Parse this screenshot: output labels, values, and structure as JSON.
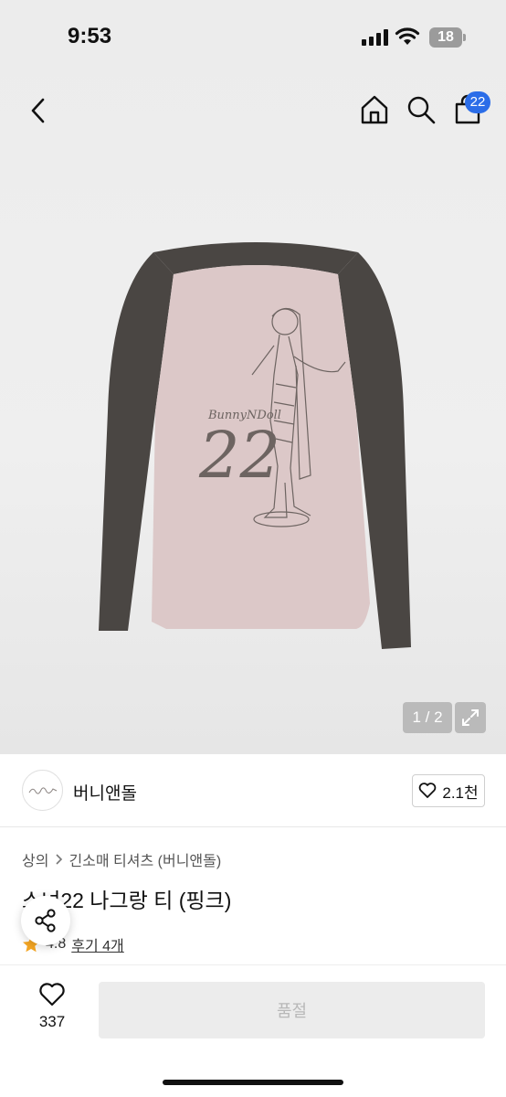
{
  "status_bar": {
    "time": "9:53",
    "battery": "18"
  },
  "header": {
    "cart_count": "22"
  },
  "gallery": {
    "counter": "1 / 2"
  },
  "product_print": {
    "brand_script": "BunnyNDoll",
    "number": "22"
  },
  "store": {
    "name": "버니앤돌",
    "likes": "2.1천"
  },
  "breadcrumb": {
    "root": "상의",
    "category": "긴소매 티셔츠 (버니앤돌)"
  },
  "product": {
    "title": "소녀22 나그랑 티 (핑크)",
    "rating": "4.8",
    "reviews": "후기 4개"
  },
  "bottom_bar": {
    "wish_count": "337",
    "buy_label": "품절"
  },
  "colors": {
    "accent_blue": "#2b6de8",
    "star": "#f5a623",
    "body_pink": "#dcc8c8",
    "sleeve_gray": "#4a4643"
  }
}
